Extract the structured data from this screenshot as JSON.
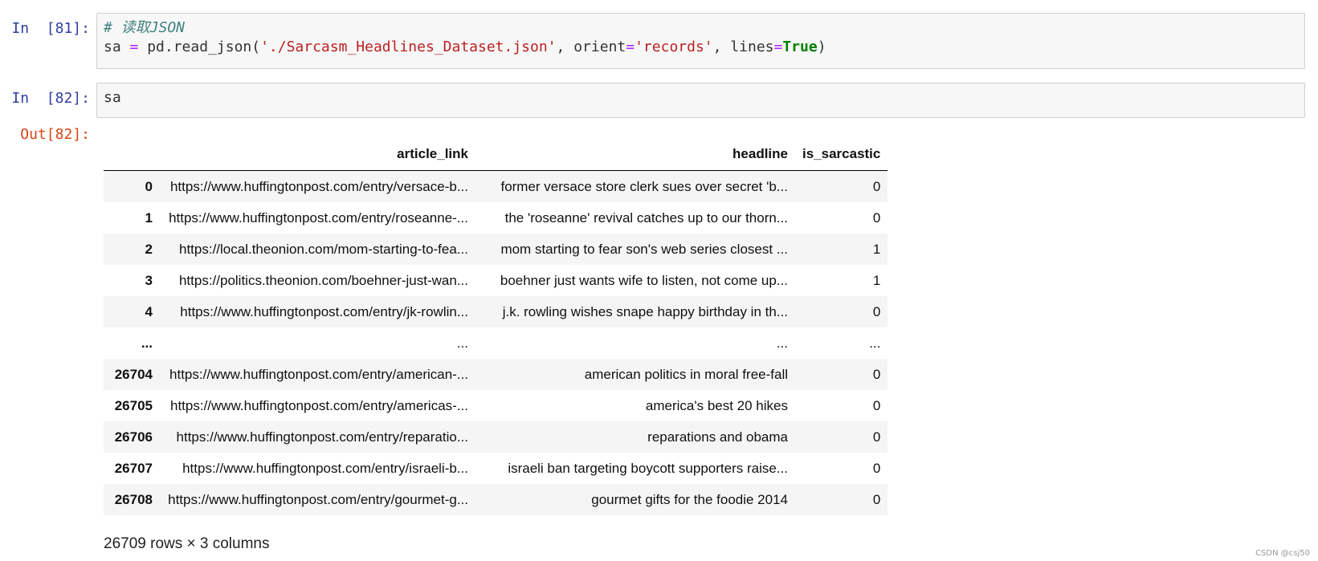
{
  "cells": [
    {
      "prompt": "In  [81]:",
      "comment": "# 读取JSON",
      "code": {
        "p1": "sa ",
        "eq1": "=",
        "p2": " pd.read_json(",
        "s1": "'./Sarcasm_Headlines_Dataset.json'",
        "p3": ", orient",
        "eq2": "=",
        "s2": "'records'",
        "p4": ", lines",
        "eq3": "=",
        "kw": "True",
        "p5": ")"
      }
    },
    {
      "prompt": "In  [82]:",
      "code_text": "sa"
    }
  ],
  "output": {
    "prompt": "Out[82]:",
    "columns": [
      "article_link",
      "headline",
      "is_sarcastic"
    ],
    "rows": [
      {
        "index": "0",
        "article_link": "https://www.huffingtonpost.com/entry/versace-b...",
        "headline": "former versace store clerk sues over secret 'b...",
        "is_sarcastic": "0"
      },
      {
        "index": "1",
        "article_link": "https://www.huffingtonpost.com/entry/roseanne-...",
        "headline": "the 'roseanne' revival catches up to our thorn...",
        "is_sarcastic": "0"
      },
      {
        "index": "2",
        "article_link": "https://local.theonion.com/mom-starting-to-fea...",
        "headline": "mom starting to fear son's web series closest ...",
        "is_sarcastic": "1"
      },
      {
        "index": "3",
        "article_link": "https://politics.theonion.com/boehner-just-wan...",
        "headline": "boehner just wants wife to listen, not come up...",
        "is_sarcastic": "1"
      },
      {
        "index": "4",
        "article_link": "https://www.huffingtonpost.com/entry/jk-rowlin...",
        "headline": "j.k. rowling wishes snape happy birthday in th...",
        "is_sarcastic": "0"
      },
      {
        "index": "...",
        "article_link": "...",
        "headline": "...",
        "is_sarcastic": "..."
      },
      {
        "index": "26704",
        "article_link": "https://www.huffingtonpost.com/entry/american-...",
        "headline": "american politics in moral free-fall",
        "is_sarcastic": "0"
      },
      {
        "index": "26705",
        "article_link": "https://www.huffingtonpost.com/entry/americas-...",
        "headline": "america's best 20 hikes",
        "is_sarcastic": "0"
      },
      {
        "index": "26706",
        "article_link": "https://www.huffingtonpost.com/entry/reparatio...",
        "headline": "reparations and obama",
        "is_sarcastic": "0"
      },
      {
        "index": "26707",
        "article_link": "https://www.huffingtonpost.com/entry/israeli-b...",
        "headline": "israeli ban targeting boycott supporters raise...",
        "is_sarcastic": "0"
      },
      {
        "index": "26708",
        "article_link": "https://www.huffingtonpost.com/entry/gourmet-g...",
        "headline": "gourmet gifts for the foodie 2014",
        "is_sarcastic": "0"
      }
    ],
    "shape": "26709 rows × 3 columns"
  },
  "watermark": "CSDN @csj50"
}
